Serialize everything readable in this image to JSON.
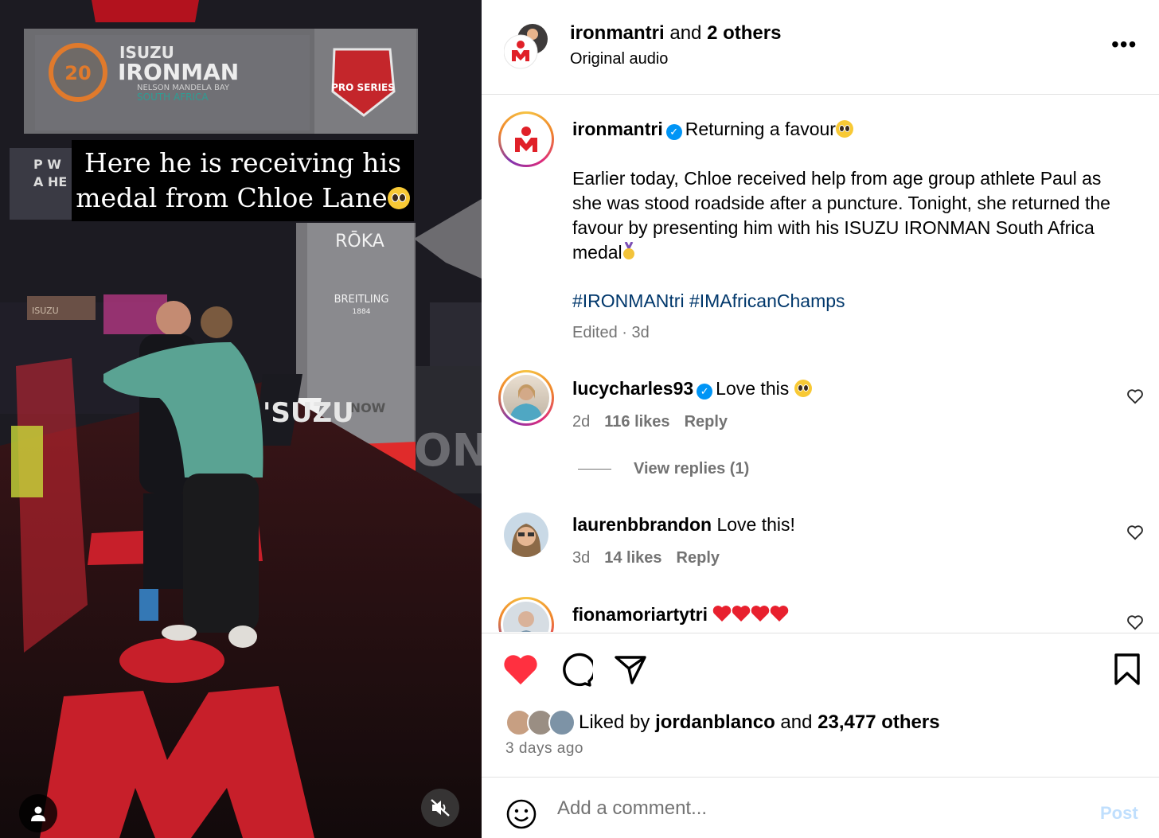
{
  "video": {
    "caption_line1": "Here he is receiving his",
    "caption_line2": "medal from Chloe Lane",
    "caption_emoji": "pleading-face",
    "user_icon": "person-icon",
    "mute_icon": "speaker-muted-icon",
    "signage": {
      "isuzu": "ISUZU",
      "ironman": "IRONMAN",
      "badge_20": "20",
      "location": "NELSON MANDELA BAY",
      "country": "SOUTH AFRICA",
      "pro_series": "PRO SERIES",
      "roka": "RŌKA",
      "breitling": "BREITLING",
      "breitling_year": "1884",
      "now": "NOW",
      "screen_text_1": "P W",
      "screen_text_2": "A HE",
      "board_isuzu": "ISUZU",
      "floor_text": "'SUZU"
    }
  },
  "header": {
    "account": "ironmantri",
    "joiner": " and ",
    "others": "2 others",
    "audio": "Original audio",
    "more_icon": "more-horizontal-icon",
    "more_label": "•••"
  },
  "caption_post": {
    "username": "ironmantri",
    "title": "Returning a favour",
    "body": "Earlier today, Chloe received help from age group athlete Paul as she was stood roadside after a puncture. Tonight, she returned the favour by presenting him with his ISUZU IRONMAN South Africa medal",
    "medal_emoji": "medal-icon",
    "hashtag1": "#IRONMANtri",
    "hashtag2": "#IMAfricanChamps",
    "meta": "Edited · 3d"
  },
  "comments": [
    {
      "username": "lucycharles93",
      "text": "Love this ",
      "verified": true,
      "time": "2d",
      "likes": "116 likes",
      "reply": "Reply"
    },
    {
      "username": "laurenbbrandon",
      "text": "Love this!",
      "verified": false,
      "time": "3d",
      "likes": "14 likes",
      "reply": "Reply"
    },
    {
      "username": "fionamoriartytri",
      "text": "",
      "verified": false,
      "hearts": 4
    }
  ],
  "view_replies": "View replies (1)",
  "actions": {
    "like_icon": "heart-filled-icon",
    "comment_icon": "comment-icon",
    "share_icon": "paper-plane-icon",
    "save_icon": "bookmark-icon",
    "liked_prefix": "Liked by ",
    "liked_user": "jordanblanco",
    "liked_joiner": " and ",
    "liked_count": "23,477 others",
    "time_ago": "3 days ago"
  },
  "add_comment": {
    "placeholder": "Add a comment...",
    "emoji_icon": "smiley-icon",
    "post_label": "Post"
  },
  "colors": {
    "like_red": "#ff3040",
    "verified_blue": "#0095f6",
    "hashtag": "#00376b",
    "muted_text": "#737373",
    "post_disabled": "#c0dffd"
  }
}
